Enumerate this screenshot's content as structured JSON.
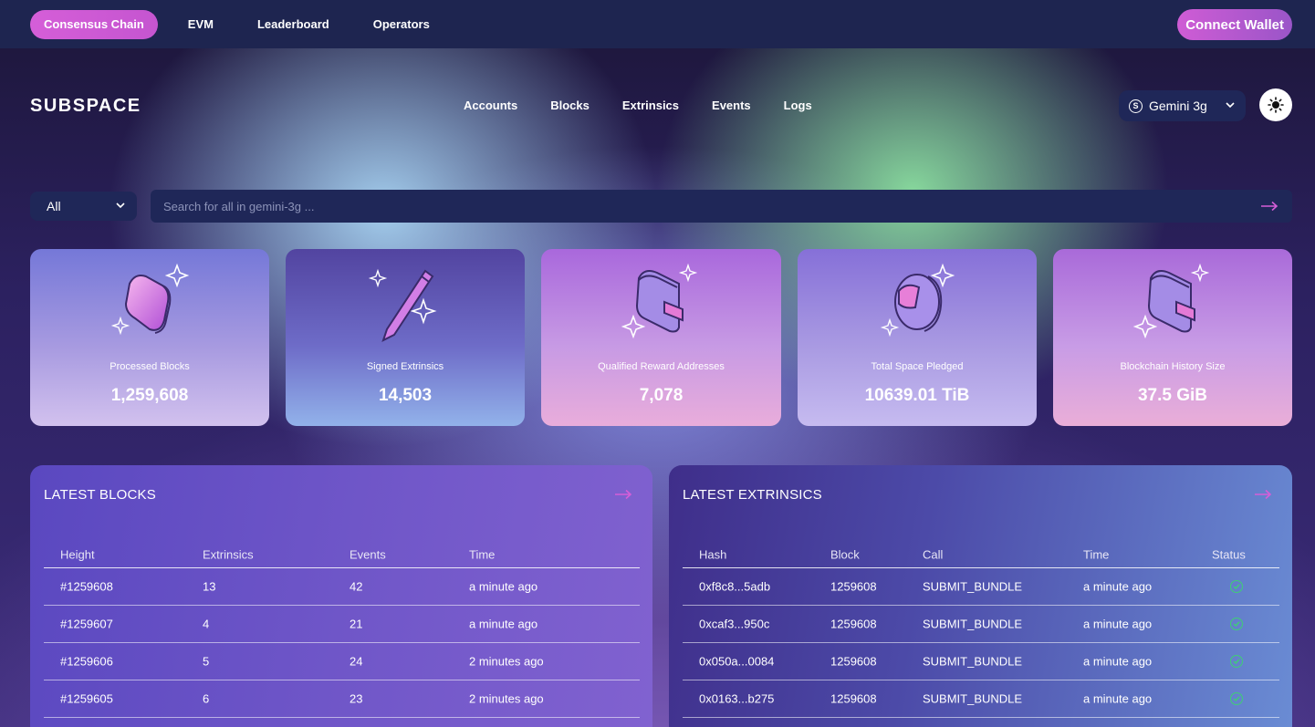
{
  "topbar": {
    "chips": [
      "Consensus Chain",
      "EVM",
      "Leaderboard",
      "Operators"
    ],
    "connect_label": "Connect Wallet"
  },
  "header": {
    "logo": "SUBSPACE",
    "nav": [
      "Accounts",
      "Blocks",
      "Extrinsics",
      "Events",
      "Logs"
    ],
    "network": "Gemini 3g"
  },
  "search": {
    "filter": "All",
    "placeholder": "Search for all in gemini-3g ..."
  },
  "stats": [
    {
      "label": "Processed Blocks",
      "value": "1,259,608",
      "icon": "cube-icon"
    },
    {
      "label": "Signed Extrinsics",
      "value": "14,503",
      "icon": "pen-icon"
    },
    {
      "label": "Qualified Reward Addresses",
      "value": "7,078",
      "icon": "wallet-icon"
    },
    {
      "label": "Total Space Pledged",
      "value": "10639.01 TiB",
      "icon": "disk-icon"
    },
    {
      "label": "Blockchain History Size",
      "value": "37.5 GiB",
      "icon": "wallet-icon"
    }
  ],
  "latest_blocks": {
    "title": "LATEST BLOCKS",
    "columns": [
      "Height",
      "Extrinsics",
      "Events",
      "Time"
    ],
    "rows": [
      {
        "height": "#1259608",
        "extrinsics": "13",
        "events": "42",
        "time": "a minute ago"
      },
      {
        "height": "#1259607",
        "extrinsics": "4",
        "events": "21",
        "time": "a minute ago"
      },
      {
        "height": "#1259606",
        "extrinsics": "5",
        "events": "24",
        "time": "2 minutes ago"
      },
      {
        "height": "#1259605",
        "extrinsics": "6",
        "events": "23",
        "time": "2 minutes ago"
      }
    ]
  },
  "latest_extrinsics": {
    "title": "LATEST EXTRINSICS",
    "columns": [
      "Hash",
      "Block",
      "Call",
      "Time",
      "Status"
    ],
    "rows": [
      {
        "hash": "0xf8c8...5adb",
        "block": "1259608",
        "call": "SUBMIT_BUNDLE",
        "time": "a minute ago",
        "status": "success"
      },
      {
        "hash": "0xcaf3...950c",
        "block": "1259608",
        "call": "SUBMIT_BUNDLE",
        "time": "a minute ago",
        "status": "success"
      },
      {
        "hash": "0x050a...0084",
        "block": "1259608",
        "call": "SUBMIT_BUNDLE",
        "time": "a minute ago",
        "status": "success"
      },
      {
        "hash": "0x0163...b275",
        "block": "1259608",
        "call": "SUBMIT_BUNDLE",
        "time": "a minute ago",
        "status": "success"
      }
    ]
  },
  "colors": {
    "accent": "#d55ed8",
    "nav_bg": "#1e2550",
    "success": "#3ecf75"
  }
}
